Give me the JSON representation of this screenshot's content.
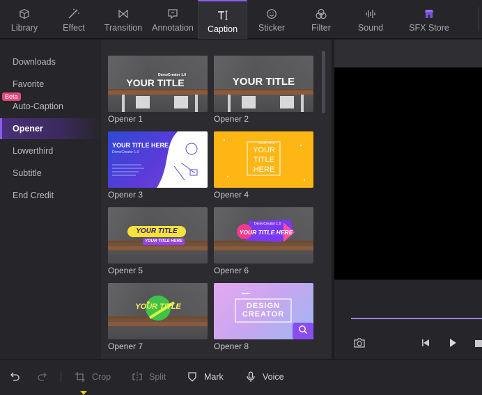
{
  "tabs": [
    {
      "label": "Library",
      "icon": "cube-icon"
    },
    {
      "label": "Effect",
      "icon": "magic-wand-icon"
    },
    {
      "label": "Transition",
      "icon": "bowtie-icon"
    },
    {
      "label": "Annotation",
      "icon": "annotation-icon"
    },
    {
      "label": "Caption",
      "icon": "text-cursor-icon",
      "active": true
    },
    {
      "label": "Sticker",
      "icon": "smiley-icon"
    },
    {
      "label": "Filter",
      "icon": "circles-icon"
    },
    {
      "label": "Sound",
      "icon": "waveform-icon"
    },
    {
      "label": "SFX Store",
      "icon": "store-icon"
    }
  ],
  "categories": [
    {
      "label": "Downloads"
    },
    {
      "label": "Favorite"
    },
    {
      "label": "Auto-Caption",
      "badge": "Beta"
    },
    {
      "label": "Opener",
      "active": true
    },
    {
      "label": "Lowerthird"
    },
    {
      "label": "Subtitle"
    },
    {
      "label": "End Credit"
    }
  ],
  "thumbs": [
    {
      "caption": "Opener 1",
      "small": "DemoCreator 1.0",
      "title": "YOUR TITLE"
    },
    {
      "caption": "Opener 2",
      "title": "YOUR TITLE"
    },
    {
      "caption": "Opener 3",
      "title": "YOUR TITLE HERE",
      "small": "DemoCreator 1.0"
    },
    {
      "caption": "Opener 4",
      "title": "YOUR TITLE HERE",
      "small": "YOUR TITLE"
    },
    {
      "caption": "Opener 5",
      "title": "YOUR TITLE",
      "sub": "YOUR TITLE HERE"
    },
    {
      "caption": "Opener 6",
      "title": "YOUR TITLE HERE",
      "small": "DemoCreator 1.0"
    },
    {
      "caption": "Opener 7",
      "title": "YOUR TITLE"
    },
    {
      "caption": "Opener 8",
      "title": "DESIGN CREATOR"
    }
  ],
  "bottom": {
    "crop": "Crop",
    "split": "Split",
    "mark": "Mark",
    "voice": "Voice"
  },
  "colors": {
    "accent": "#8a5cf6",
    "beta": "#e8477a",
    "playhead": "#f2c230"
  }
}
